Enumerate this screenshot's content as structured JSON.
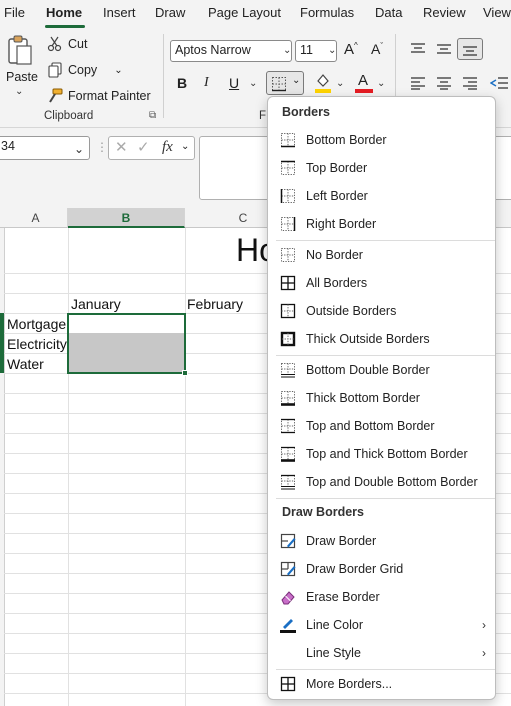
{
  "tabs": [
    "File",
    "Home",
    "Insert",
    "Draw",
    "Page Layout",
    "Formulas",
    "Data",
    "Review",
    "View"
  ],
  "clipboard": {
    "paste": "Paste",
    "cut": "Cut",
    "copy": "Copy",
    "format_painter": "Format Painter",
    "group_label": "Clipboard"
  },
  "font": {
    "name": "Aptos Narrow",
    "size": "11",
    "bold": "B",
    "italic": "I",
    "underline": "U",
    "grow": "A^",
    "shrink": "Aˇ",
    "font_color_glyph": "A",
    "group_label_partial": "F"
  },
  "formula_bar": {
    "name_box": "34",
    "fx": "fx"
  },
  "columns": [
    "A",
    "B",
    "C"
  ],
  "cells": {
    "title_partial": "Ho",
    "january": "January",
    "february": "February",
    "rows": [
      "Mortgage",
      "Electricity",
      "Water"
    ]
  },
  "colors": {
    "accent": "#1d6b3a",
    "fill_highlight": "#ffd400",
    "font_red": "#e51c23",
    "selection_fill": "#c7c7c7"
  },
  "menu": {
    "heading_borders": "Borders",
    "heading_draw": "Draw Borders",
    "items_1": [
      {
        "label": "Bottom Border",
        "icon": "bottom-border-icon"
      },
      {
        "label": "Top Border",
        "icon": "top-border-icon"
      },
      {
        "label": "Left Border",
        "icon": "left-border-icon"
      },
      {
        "label": "Right Border",
        "icon": "right-border-icon"
      }
    ],
    "items_2": [
      {
        "label": "No Border",
        "icon": "no-border-icon"
      },
      {
        "label": "All Borders",
        "icon": "all-borders-icon"
      },
      {
        "label": "Outside Borders",
        "icon": "outside-borders-icon"
      },
      {
        "label": "Thick Outside Borders",
        "icon": "thick-outside-borders-icon"
      }
    ],
    "items_3": [
      {
        "label": "Bottom Double Border",
        "icon": "bottom-double-border-icon"
      },
      {
        "label": "Thick Bottom Border",
        "icon": "thick-bottom-border-icon"
      },
      {
        "label": "Top and Bottom Border",
        "icon": "top-bottom-border-icon"
      },
      {
        "label": "Top and Thick Bottom Border",
        "icon": "top-thick-bottom-border-icon"
      },
      {
        "label": "Top and Double Bottom Border",
        "icon": "top-double-bottom-border-icon"
      }
    ],
    "items_draw": [
      {
        "label": "Draw Border",
        "icon": "draw-border-icon"
      },
      {
        "label": "Draw Border Grid",
        "icon": "draw-border-grid-icon"
      },
      {
        "label": "Erase Border",
        "icon": "eraser-icon"
      },
      {
        "label": "Line Color",
        "icon": "line-color-icon"
      },
      {
        "label": "Line Style",
        "icon": "line-style-icon"
      }
    ],
    "more": {
      "label": "More Borders...",
      "icon": "more-borders-icon"
    }
  }
}
